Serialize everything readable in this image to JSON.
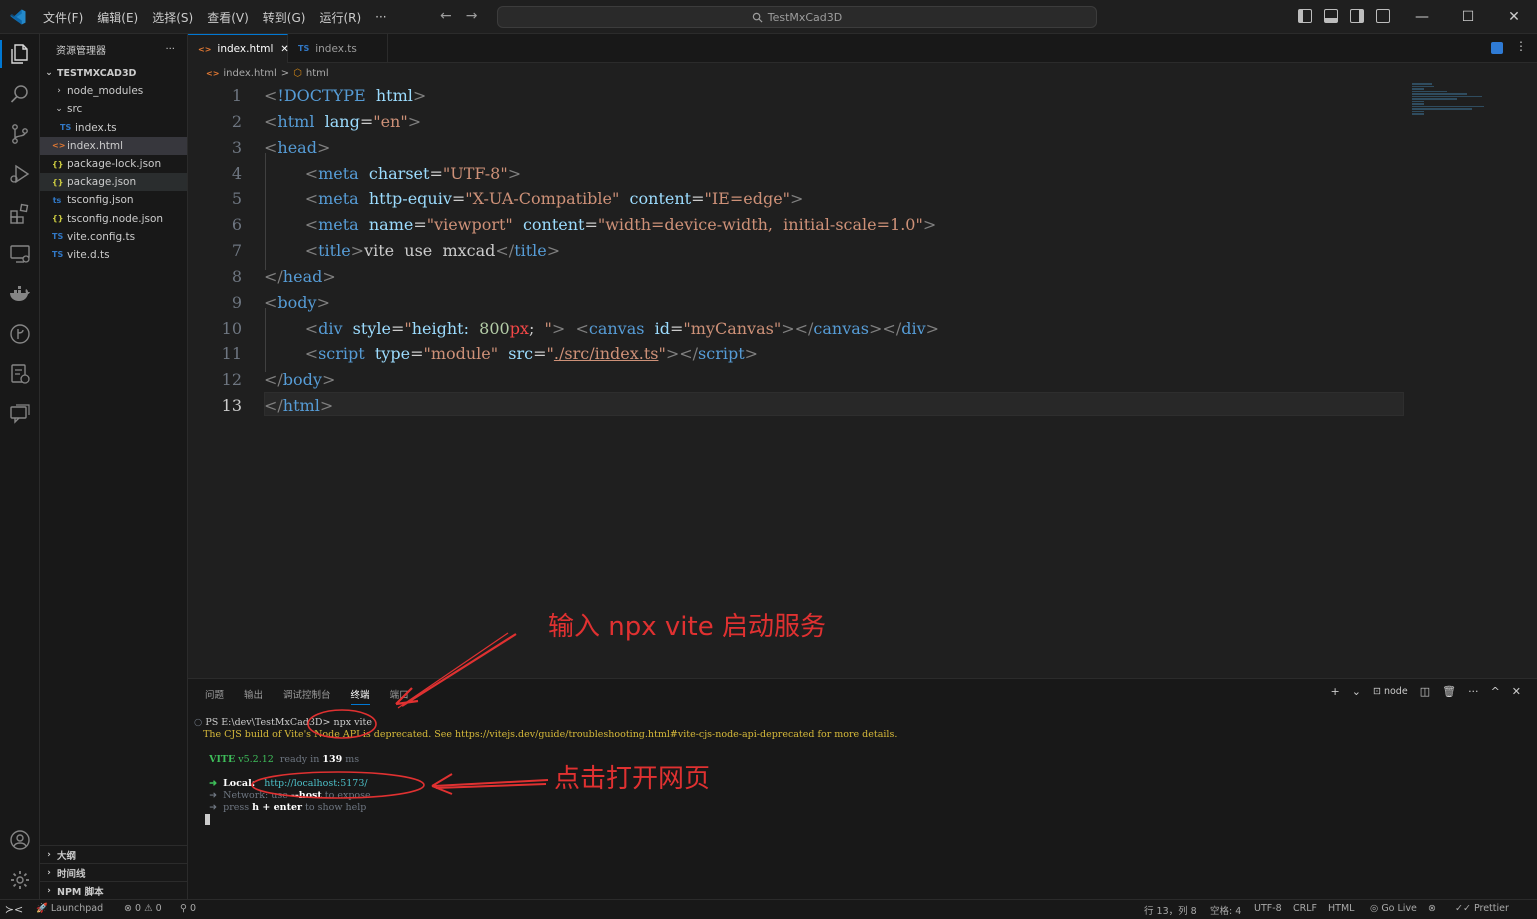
{
  "titlebar": {
    "menu": [
      "文件(F)",
      "编辑(E)",
      "选择(S)",
      "查看(V)",
      "转到(G)",
      "运行(R)",
      "···"
    ],
    "search": "TestMxCad3D",
    "nav_back": "←",
    "nav_forward": "→",
    "win_minimize": "—",
    "win_maximize": "☐",
    "win_close": "✕"
  },
  "sidebar": {
    "title": "资源管理器",
    "more": "···",
    "project": "TESTMXCAD3D",
    "items": [
      {
        "chev": "›",
        "icon": "",
        "label": "node_modules"
      },
      {
        "chev": "⌄",
        "icon": "",
        "label": "src"
      },
      {
        "chev": "",
        "icon": "TS",
        "label": "index.ts"
      },
      {
        "chev": "",
        "icon": "<>",
        "label": "index.html"
      },
      {
        "chev": "",
        "icon": "{}",
        "label": "package-lock.json"
      },
      {
        "chev": "",
        "icon": "{}",
        "label": "package.json"
      },
      {
        "chev": "",
        "icon": "ts",
        "label": "tsconfig.json"
      },
      {
        "chev": "",
        "icon": "{}",
        "label": "tsconfig.node.json"
      },
      {
        "chev": "",
        "icon": "TS",
        "label": "vite.config.ts"
      },
      {
        "chev": "",
        "icon": "TS",
        "label": "vite.d.ts"
      }
    ],
    "bottom_sections": [
      "大纲",
      "时间线",
      "NPM 脚本"
    ]
  },
  "tabs": [
    {
      "icon": "<>",
      "label": "index.html",
      "close": "✕"
    },
    {
      "icon": "TS",
      "label": "index.ts"
    }
  ],
  "breadcrumb": {
    "file_icon": "<>",
    "file": "index.html",
    "sep": ">",
    "element_icon": "⬡",
    "element": "html"
  },
  "editor": {
    "line_numbers": [
      "1",
      "2",
      "3",
      "4",
      "5",
      "6",
      "7",
      "8",
      "9",
      "10",
      "11",
      "12",
      "13"
    ],
    "line1": {
      "open": "<",
      "tag": "!DOCTYPE",
      "attr": "html",
      "close": ">"
    },
    "line2": {
      "tag": "html",
      "attr": "lang",
      "val": "\"en\""
    },
    "line3": {
      "tag": "head"
    },
    "line4": {
      "tag": "meta",
      "attr": "charset",
      "val": "\"UTF-8\""
    },
    "line5": {
      "tag": "meta",
      "attr1": "http-equiv",
      "val1": "\"X-UA-Compatible\"",
      "attr2": "content",
      "val2": "\"IE=edge\""
    },
    "line6": {
      "tag": "meta",
      "attr1": "name",
      "val1": "\"viewport\"",
      "attr2": "content",
      "val2": "\"width=device-width,  initial-scale=1.0\""
    },
    "line7": {
      "tag": "title",
      "text": "vite  use  mxcad"
    },
    "line8": {
      "tag": "head"
    },
    "line9": {
      "tag": "body"
    },
    "line10": {
      "tag": "div",
      "attr": "style",
      "q": "\"",
      "prop": "height:",
      "num": "800",
      "unit": "px",
      "rest": ";  ",
      "tag2": "canvas",
      "attr2": "id",
      "val2": "\"myCanvas\""
    },
    "line11": {
      "tag": "script",
      "attr1": "type",
      "val1": "\"module\"",
      "attr2": "src",
      "q": "\"",
      "link": "./src/index.ts"
    },
    "line12": {
      "tag": "body"
    },
    "line13": {
      "tag": "html"
    }
  },
  "annotations": {
    "top": "输入 npx vite 启动服务",
    "bottom": "点击打开网页",
    "color": "#e03131"
  },
  "panel": {
    "tabs": [
      "问题",
      "输出",
      "调试控制台",
      "终端",
      "端口"
    ],
    "active_tab": "终端",
    "terminal_name": "node",
    "controls": {
      "add": "+",
      "dropdown": "⌄",
      "split": "◫",
      "trash": "🗑",
      "more": "···",
      "maximize": "^",
      "close": "✕"
    },
    "terminal": {
      "bullet": "○",
      "prompt": "PS E:\\dev\\TestMxCad3D> ",
      "command": "npx vite",
      "warning": "The CJS build of Vite's Node API is deprecated. See https://vitejs.dev/guide/troubleshooting.html#vite-cjs-node-api-deprecated for more details.",
      "vite_name": "VITE",
      "vite_version": " v5.2.12",
      "ready_text": "  ready in ",
      "ready_ms": "139",
      "ms_unit": " ms",
      "arrow": "➜",
      "local_label": "Local:",
      "local_url": "http://localhost:5173/",
      "network_label": "Network:",
      "network_pre": "use ",
      "network_flag": "--host",
      "network_post": " to expose",
      "press": "press ",
      "h": "h",
      "plus": " + ",
      "enter": "enter",
      "help": " to show help"
    }
  },
  "statusbar": {
    "remote": "≻<",
    "launchpad": "Launchpad",
    "errors": "⊗ 0",
    "warnings": "⚠ 0",
    "ports": "0",
    "position": "行 13，列 8",
    "spaces": "空格: 4",
    "encoding": "UTF-8",
    "eol": "CRLF",
    "language": "HTML",
    "golive": "Go Live",
    "prettier": "Prettier"
  }
}
